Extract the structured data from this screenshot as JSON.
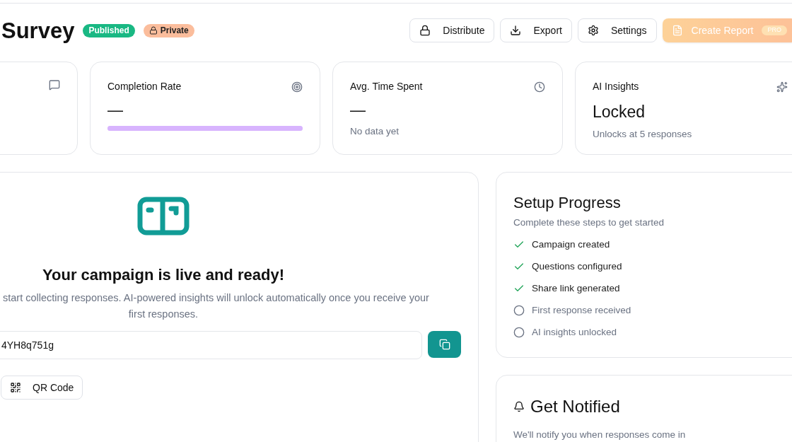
{
  "header": {
    "title": "Survey",
    "badges": [
      {
        "label": "Published",
        "kind": "status"
      },
      {
        "label": "Private",
        "kind": "lock"
      }
    ],
    "actions": [
      {
        "label": "Distribute",
        "kind": "lock"
      },
      {
        "label": "Export",
        "kind": "download"
      },
      {
        "label": "Settings",
        "kind": "gear"
      }
    ],
    "primary": {
      "label": "Create Report",
      "badge": "PRO",
      "disabled": true
    }
  },
  "stats": [
    {
      "kind": "chat"
    },
    {
      "kind": "target",
      "title": "Completion Rate",
      "value": "—",
      "level": 1
    },
    {
      "kind": "clock",
      "title": "Avg. Time Spent",
      "value": "—",
      "note": "No data yet"
    },
    {
      "kind": "sparkle",
      "title": "AI Insights",
      "value": "Locked",
      "note": "Unlocks at 5 responses"
    }
  ],
  "campaign": {
    "heading": "Your campaign is live and ready!",
    "text_lines": [
      "start collecting responses. AI-powered insights will unlock automatically once you receive your",
      "first responses."
    ],
    "link": "4YH8q751g",
    "qr_button": "QR Code"
  },
  "setup": {
    "title": "Setup Progress",
    "subtitle": "Complete these steps to get started",
    "steps": [
      {
        "label": "Campaign created",
        "done": true
      },
      {
        "label": "Questions configured",
        "done": true
      },
      {
        "label": "Share link generated",
        "done": true
      },
      {
        "label": "First response received",
        "done": false
      },
      {
        "label": "AI insights unlocked",
        "done": false
      }
    ]
  },
  "notify": {
    "title": "Get Notified",
    "text": "We'll notify you when responses come in"
  }
}
